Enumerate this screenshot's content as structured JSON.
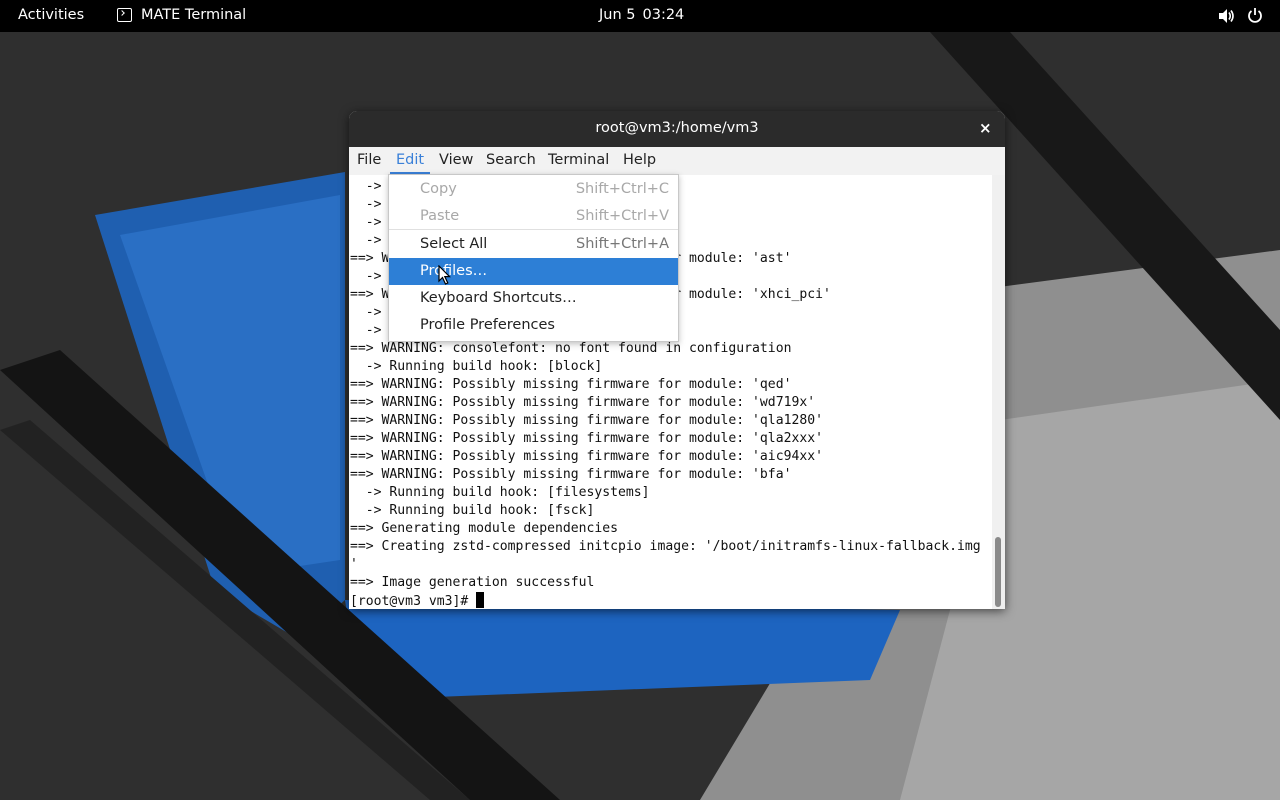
{
  "topbar": {
    "activities": "Activities",
    "app_name": "MATE Terminal",
    "date": "Jun 5",
    "time": "03:24",
    "volume_icon": "speaker-volume-icon",
    "power_icon": "power-icon"
  },
  "window": {
    "title": "root@vm3:/home/vm3",
    "close_glyph": "×"
  },
  "menubar": {
    "items": [
      "File",
      "Edit",
      "View",
      "Search",
      "Terminal",
      "Help"
    ],
    "active": "Edit",
    "accent_color": "#3a80d8"
  },
  "terminal": {
    "lines": [
      "  ->",
      "  ->",
      "  ->",
      "  ->",
      "==> W                                    r module: 'ast'",
      "  ->",
      "==> W                                    r module: 'xhci_pci'",
      "  ->",
      "  ->",
      "==> WARNING: consolefont: no font found in configuration",
      "  -> Running build hook: [block]",
      "==> WARNING: Possibly missing firmware for module: 'qed'",
      "==> WARNING: Possibly missing firmware for module: 'wd719x'",
      "==> WARNING: Possibly missing firmware for module: 'qla1280'",
      "==> WARNING: Possibly missing firmware for module: 'qla2xxx'",
      "==> WARNING: Possibly missing firmware for module: 'aic94xx'",
      "==> WARNING: Possibly missing firmware for module: 'bfa'",
      "  -> Running build hook: [filesystems]",
      "  -> Running build hook: [fsck]",
      "==> Generating module dependencies",
      "==> Creating zstd-compressed initcpio image: '/boot/initramfs-linux-fallback.img",
      "'",
      "==> Image generation successful"
    ],
    "prompt": "[root@vm3 vm3]# "
  },
  "edit_menu": {
    "items": [
      {
        "label": "Copy",
        "accel": "Shift+Ctrl+C",
        "state": "disabled"
      },
      {
        "label": "Paste",
        "accel": "Shift+Ctrl+V",
        "state": "disabled"
      },
      {
        "label": "Select All",
        "accel": "Shift+Ctrl+A",
        "state": "normal"
      },
      {
        "label": "Profiles…",
        "accel": "",
        "state": "highlighted"
      },
      {
        "label": "Keyboard Shortcuts…",
        "accel": "",
        "state": "normal"
      },
      {
        "label": "Profile Preferences",
        "accel": "",
        "state": "normal"
      }
    ],
    "highlight_color": "#2d7fd6"
  }
}
